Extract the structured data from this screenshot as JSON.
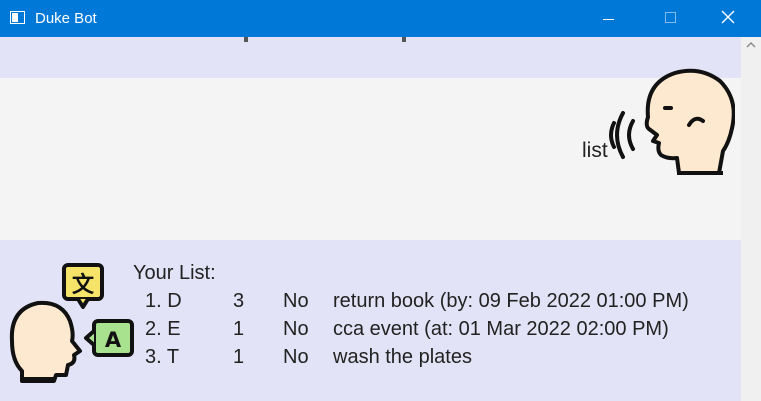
{
  "window": {
    "title": "Duke Bot",
    "minimize_icon": "minimize-icon",
    "maximize_icon": "maximize-icon",
    "close_icon": "close-icon",
    "accent": "#0078d7"
  },
  "chat": {
    "user_message": "list",
    "bot_header": "Your List:",
    "tasks": [
      {
        "number": "1. D",
        "amount": "3",
        "done": "No",
        "description": "return book (by: 09 Feb 2022 01:00 PM)"
      },
      {
        "number": "2. E",
        "amount": "1",
        "done": "No",
        "description": "cca event (at: 01 Mar 2022 02:00 PM)"
      },
      {
        "number": "3. T",
        "amount": "1",
        "done": "No",
        "description": "wash the plates"
      }
    ],
    "bot_bubble_colors": {
      "background": "#e3e3f7",
      "user_background": "#f4f4f4"
    }
  }
}
